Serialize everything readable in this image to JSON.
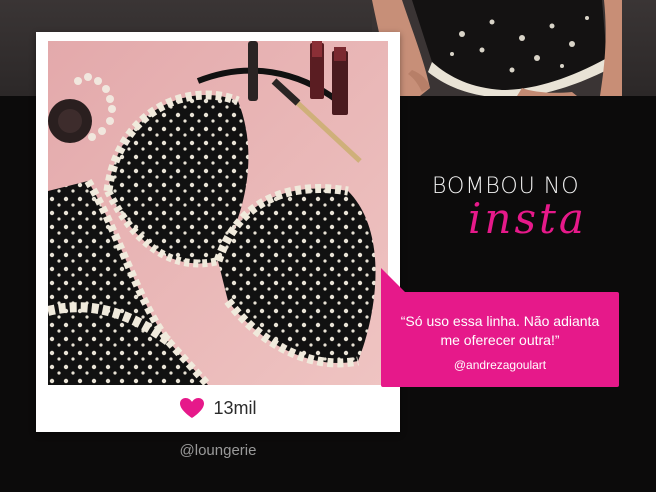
{
  "heading": {
    "line1": "BOMBOU NO",
    "line2": "insta"
  },
  "post": {
    "likes_count": "13mil",
    "account": "@loungerie"
  },
  "quote": {
    "text": "“Só uso essa linha. Não adianta me oferecer outra!”",
    "author": "@andrezagoulart"
  },
  "colors": {
    "accent": "#e6198a",
    "background_dark": "#0c0b0b",
    "background_top": "#332f2f",
    "card": "#ffffff",
    "photo_backdrop": "#e7b8b8"
  },
  "icons": {
    "likes": "heart-icon"
  }
}
